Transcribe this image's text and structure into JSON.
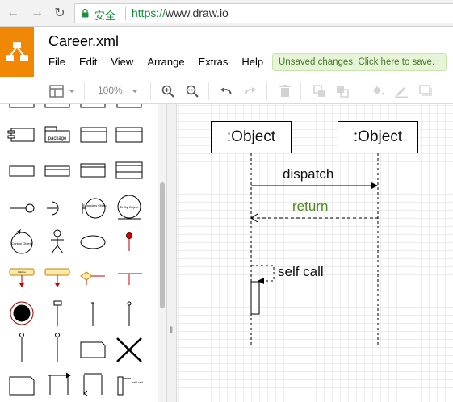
{
  "browser": {
    "secure_label": "安全",
    "url_scheme": "https://",
    "url_host": "www.draw.io"
  },
  "app": {
    "title": "Career.xml",
    "menu": [
      "File",
      "Edit",
      "View",
      "Arrange",
      "Extras",
      "Help"
    ],
    "unsaved_notice": "Unsaved changes. Click here to save.",
    "accent_color": "#f08705"
  },
  "toolbar": {
    "zoom": "100%",
    "icons": [
      "format-panel-icon",
      "zoom-in-icon",
      "zoom-out-icon",
      "undo-icon",
      "redo-icon",
      "delete-icon",
      "to-front-icon",
      "to-back-icon",
      "fill-color-icon",
      "line-color-icon",
      "shadow-icon"
    ]
  },
  "shapes": {
    "package_label": "package",
    "lifeline_label": "Lifeline",
    "boundary_label": "Boundary Object",
    "entity_label": "Entity Object",
    "control_label": "Control Object",
    "self_call_label": "self call"
  },
  "diagram": {
    "lifeline_a_label": ":Object",
    "lifeline_b_label": ":Object",
    "dispatch_label": "dispatch",
    "return_label": "return",
    "return_color": "#4d8a1e",
    "self_call_label": "self call"
  }
}
